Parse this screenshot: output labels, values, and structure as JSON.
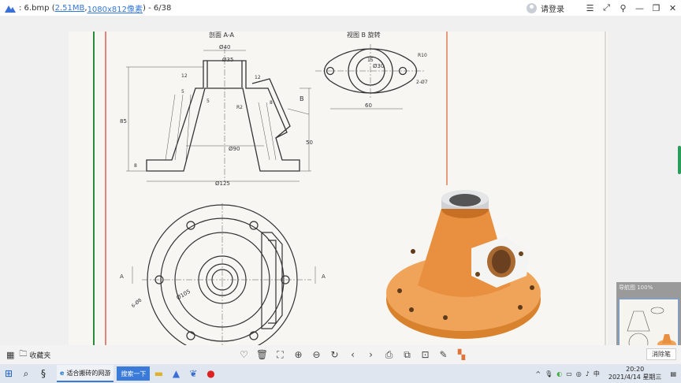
{
  "titlebar": {
    "prefix": ": 6.bmp (",
    "size_link": "2.51MB",
    "sep": " , ",
    "dim_link": "1080x812像素",
    "suffix": ") - 6/38",
    "login": "请登录"
  },
  "drawing": {
    "section_title": "剖面 A-A",
    "view_title": "视图 B 旋转",
    "dims": {
      "d40": "Ø40",
      "d35": "Ø35",
      "h5": "5",
      "h12": "12",
      "h5b": "5",
      "r2": "R2",
      "n12": "12",
      "n8": "8",
      "b": "B",
      "h85": "85",
      "h50": "50",
      "h8": "8",
      "d90": "Ø90",
      "d125": "Ø125",
      "v15": "15",
      "d30": "Ø30",
      "r10": "R10",
      "d7": "2-Ø7",
      "w60": "60",
      "holes": "6-Ø8",
      "d105": "Ø105",
      "a_left": "A",
      "a_right": "A"
    }
  },
  "thumbnail": {
    "title": "导航图 100%"
  },
  "toolbar": {
    "favorites": "收藏夹",
    "eraser": "消除笔"
  },
  "taskbar": {
    "browser_tab": "适合搬砖的网游",
    "search": "搜索一下",
    "ime": "中",
    "time": "20:20",
    "date": "2021/4/14 星期三"
  }
}
